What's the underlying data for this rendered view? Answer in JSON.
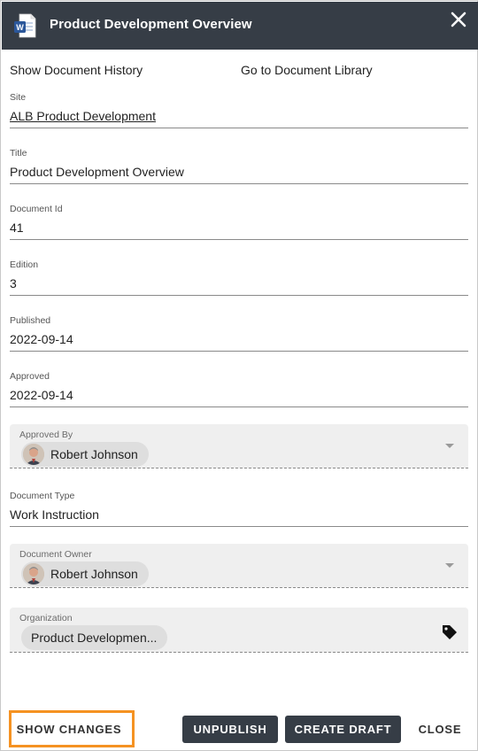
{
  "header": {
    "title": "Product Development Overview",
    "icon": "word-document-icon",
    "close_icon": "close-icon"
  },
  "links": {
    "history": "Show Document History",
    "library": "Go to Document Library"
  },
  "fields": {
    "site": {
      "label": "Site",
      "value": "ALB Product Development"
    },
    "title": {
      "label": "Title",
      "value": "Product Development Overview"
    },
    "document_id": {
      "label": "Document Id",
      "value": "41"
    },
    "edition": {
      "label": "Edition",
      "value": "3"
    },
    "published": {
      "label": "Published",
      "value": "2022-09-14"
    },
    "approved": {
      "label": "Approved",
      "value": "2022-09-14"
    },
    "approved_by": {
      "label": "Approved By",
      "value": "Robert Johnson"
    },
    "document_type": {
      "label": "Document Type",
      "value": "Work Instruction"
    },
    "document_owner": {
      "label": "Document Owner",
      "value": "Robert Johnson"
    },
    "organization": {
      "label": "Organization",
      "value": "Product Developmen..."
    }
  },
  "footer": {
    "show_changes": "SHOW CHANGES",
    "unpublish": "UNPUBLISH",
    "create_draft": "CREATE DRAFT",
    "close": "CLOSE"
  },
  "colors": {
    "header_bg": "#363d46",
    "highlight": "#f59222",
    "word_blue": "#2b579a"
  }
}
